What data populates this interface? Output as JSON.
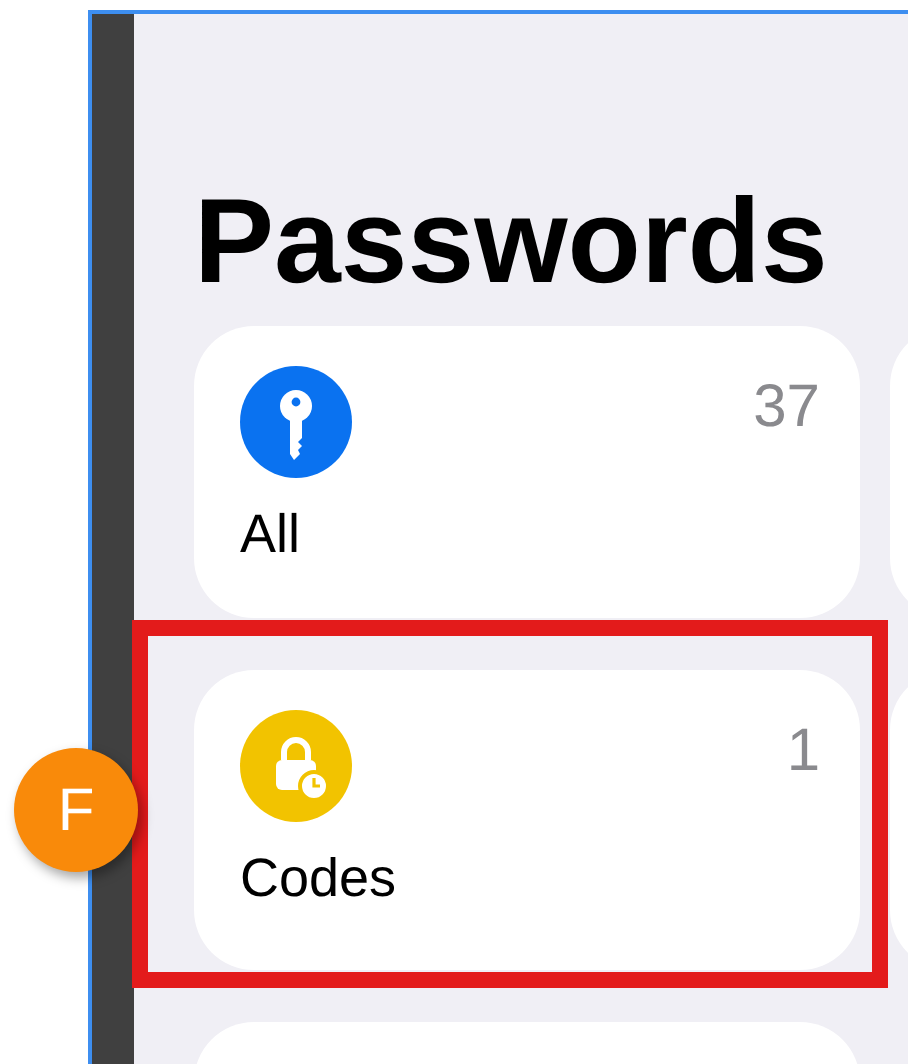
{
  "title": "Passwords",
  "categories": [
    {
      "kind": "key",
      "label": "All",
      "count": "37",
      "color": "#0a72f0",
      "highlighted": false
    },
    {
      "kind": "blank"
    },
    {
      "kind": "code",
      "label": "Codes",
      "count": "1",
      "color": "#f2c300",
      "highlighted": true
    },
    {
      "kind": "blank"
    },
    {
      "kind": "blank"
    }
  ],
  "annotation": {
    "label": "F"
  }
}
